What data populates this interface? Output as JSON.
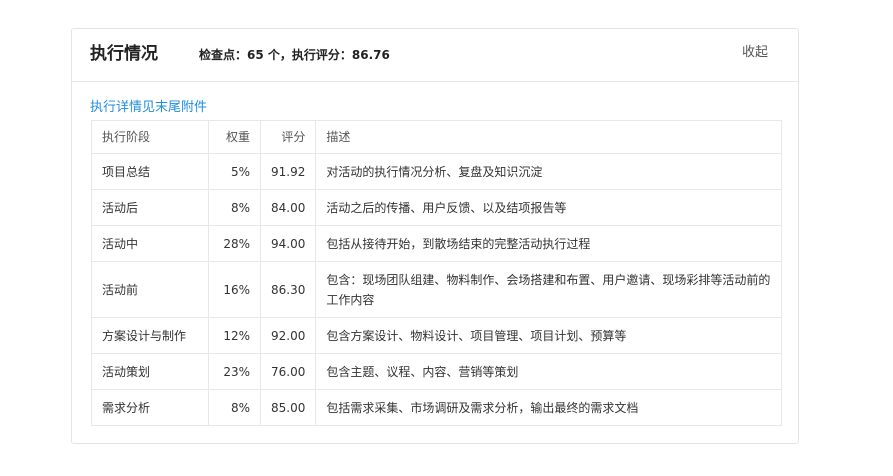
{
  "header": {
    "title": "执行情况",
    "summary": "检查点：65 个，执行评分：86.76",
    "collapse_label": "收起"
  },
  "detail_link": "执行详情见末尾附件",
  "table": {
    "columns": [
      "执行阶段",
      "权重",
      "评分",
      "描述"
    ],
    "rows": [
      {
        "stage": "项目总结",
        "weight": "5%",
        "score": "91.92",
        "desc": "对活动的执行情况分析、复盘及知识沉淀"
      },
      {
        "stage": "活动后",
        "weight": "8%",
        "score": "84.00",
        "desc": "活动之后的传播、用户反馈、以及结项报告等"
      },
      {
        "stage": "活动中",
        "weight": "28%",
        "score": "94.00",
        "desc": "包括从接待开始，到散场结束的完整活动执行过程"
      },
      {
        "stage": "活动前",
        "weight": "16%",
        "score": "86.30",
        "desc": "包含：现场团队组建、物料制作、会场搭建和布置、用户邀请、现场彩排等活动前的工作内容"
      },
      {
        "stage": "方案设计与制作",
        "weight": "12%",
        "score": "92.00",
        "desc": "包含方案设计、物料设计、项目管理、项目计划、预算等"
      },
      {
        "stage": "活动策划",
        "weight": "23%",
        "score": "76.00",
        "desc": "包含主题、议程、内容、营销等策划"
      },
      {
        "stage": "需求分析",
        "weight": "8%",
        "score": "85.00",
        "desc": "包括需求采集、市场调研及需求分析，输出最终的需求文档"
      }
    ]
  }
}
